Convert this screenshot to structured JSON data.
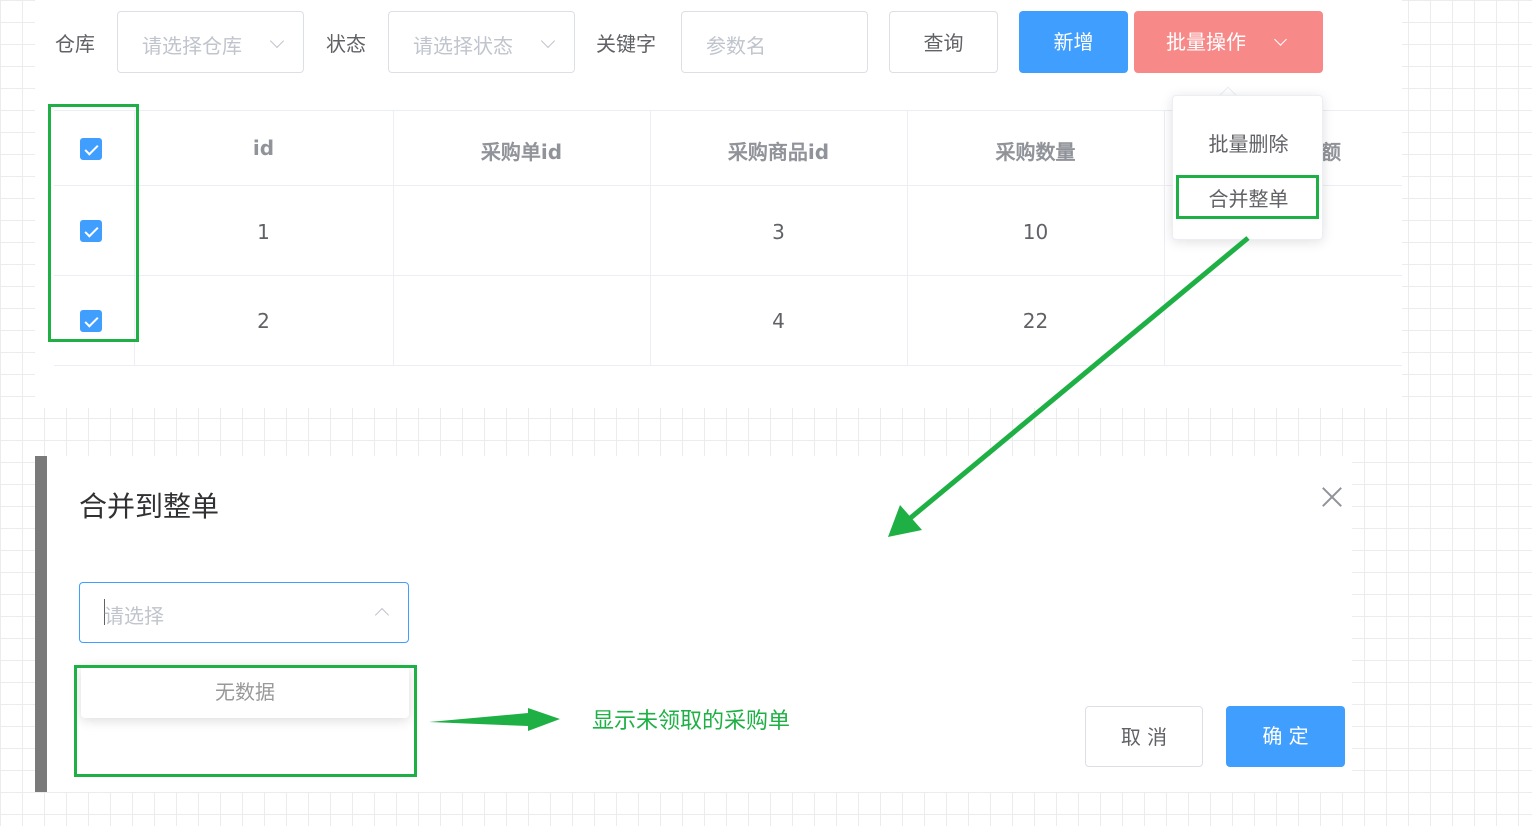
{
  "filters": {
    "warehouse_label": "仓库",
    "warehouse_placeholder": "请选择仓库",
    "status_label": "状态",
    "status_placeholder": "请选择状态",
    "keyword_label": "关键字",
    "keyword_placeholder": "参数名"
  },
  "toolbar": {
    "query_label": "查询",
    "add_label": "新增",
    "batch_label": "批量操作"
  },
  "table": {
    "headers": [
      "id",
      "采购单id",
      "采购商品id",
      "采购数量",
      "额"
    ],
    "rows": [
      {
        "id": "1",
        "purchase_id": "",
        "sku_id": "3",
        "quantity": "10"
      },
      {
        "id": "2",
        "purchase_id": "",
        "sku_id": "4",
        "quantity": "22"
      }
    ]
  },
  "batch_menu": {
    "items": [
      "批量删除",
      "合并整单"
    ]
  },
  "dialog": {
    "title": "合并到整单",
    "select_placeholder": "请选择",
    "empty_text": "无数据",
    "annotation": "显示未领取的采购单",
    "cancel_label": "取 消",
    "ok_label": "确 定"
  },
  "colors": {
    "primary": "#409eff",
    "danger_light": "#f78989",
    "highlight": "#1fb045"
  }
}
